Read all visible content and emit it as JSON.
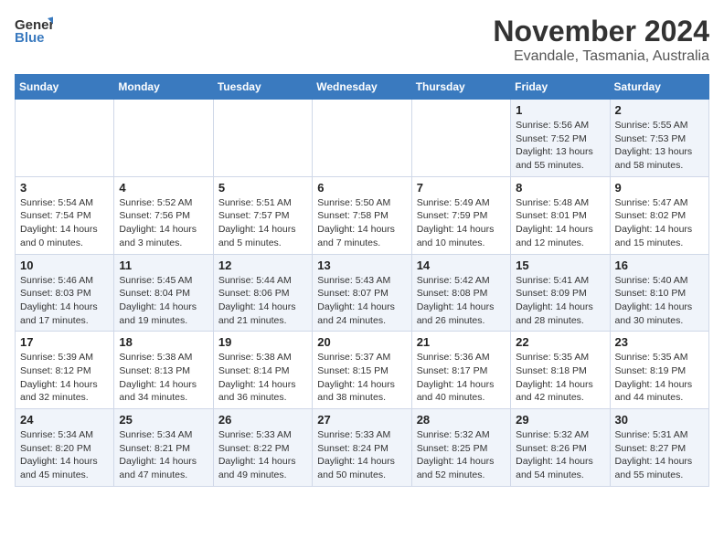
{
  "header": {
    "logo_general": "General",
    "logo_blue": "Blue",
    "month_title": "November 2024",
    "location": "Evandale, Tasmania, Australia"
  },
  "calendar": {
    "days_of_week": [
      "Sunday",
      "Monday",
      "Tuesday",
      "Wednesday",
      "Thursday",
      "Friday",
      "Saturday"
    ],
    "weeks": [
      [
        {
          "day": "",
          "info": ""
        },
        {
          "day": "",
          "info": ""
        },
        {
          "day": "",
          "info": ""
        },
        {
          "day": "",
          "info": ""
        },
        {
          "day": "",
          "info": ""
        },
        {
          "day": "1",
          "info": "Sunrise: 5:56 AM\nSunset: 7:52 PM\nDaylight: 13 hours and 55 minutes."
        },
        {
          "day": "2",
          "info": "Sunrise: 5:55 AM\nSunset: 7:53 PM\nDaylight: 13 hours and 58 minutes."
        }
      ],
      [
        {
          "day": "3",
          "info": "Sunrise: 5:54 AM\nSunset: 7:54 PM\nDaylight: 14 hours and 0 minutes."
        },
        {
          "day": "4",
          "info": "Sunrise: 5:52 AM\nSunset: 7:56 PM\nDaylight: 14 hours and 3 minutes."
        },
        {
          "day": "5",
          "info": "Sunrise: 5:51 AM\nSunset: 7:57 PM\nDaylight: 14 hours and 5 minutes."
        },
        {
          "day": "6",
          "info": "Sunrise: 5:50 AM\nSunset: 7:58 PM\nDaylight: 14 hours and 7 minutes."
        },
        {
          "day": "7",
          "info": "Sunrise: 5:49 AM\nSunset: 7:59 PM\nDaylight: 14 hours and 10 minutes."
        },
        {
          "day": "8",
          "info": "Sunrise: 5:48 AM\nSunset: 8:01 PM\nDaylight: 14 hours and 12 minutes."
        },
        {
          "day": "9",
          "info": "Sunrise: 5:47 AM\nSunset: 8:02 PM\nDaylight: 14 hours and 15 minutes."
        }
      ],
      [
        {
          "day": "10",
          "info": "Sunrise: 5:46 AM\nSunset: 8:03 PM\nDaylight: 14 hours and 17 minutes."
        },
        {
          "day": "11",
          "info": "Sunrise: 5:45 AM\nSunset: 8:04 PM\nDaylight: 14 hours and 19 minutes."
        },
        {
          "day": "12",
          "info": "Sunrise: 5:44 AM\nSunset: 8:06 PM\nDaylight: 14 hours and 21 minutes."
        },
        {
          "day": "13",
          "info": "Sunrise: 5:43 AM\nSunset: 8:07 PM\nDaylight: 14 hours and 24 minutes."
        },
        {
          "day": "14",
          "info": "Sunrise: 5:42 AM\nSunset: 8:08 PM\nDaylight: 14 hours and 26 minutes."
        },
        {
          "day": "15",
          "info": "Sunrise: 5:41 AM\nSunset: 8:09 PM\nDaylight: 14 hours and 28 minutes."
        },
        {
          "day": "16",
          "info": "Sunrise: 5:40 AM\nSunset: 8:10 PM\nDaylight: 14 hours and 30 minutes."
        }
      ],
      [
        {
          "day": "17",
          "info": "Sunrise: 5:39 AM\nSunset: 8:12 PM\nDaylight: 14 hours and 32 minutes."
        },
        {
          "day": "18",
          "info": "Sunrise: 5:38 AM\nSunset: 8:13 PM\nDaylight: 14 hours and 34 minutes."
        },
        {
          "day": "19",
          "info": "Sunrise: 5:38 AM\nSunset: 8:14 PM\nDaylight: 14 hours and 36 minutes."
        },
        {
          "day": "20",
          "info": "Sunrise: 5:37 AM\nSunset: 8:15 PM\nDaylight: 14 hours and 38 minutes."
        },
        {
          "day": "21",
          "info": "Sunrise: 5:36 AM\nSunset: 8:17 PM\nDaylight: 14 hours and 40 minutes."
        },
        {
          "day": "22",
          "info": "Sunrise: 5:35 AM\nSunset: 8:18 PM\nDaylight: 14 hours and 42 minutes."
        },
        {
          "day": "23",
          "info": "Sunrise: 5:35 AM\nSunset: 8:19 PM\nDaylight: 14 hours and 44 minutes."
        }
      ],
      [
        {
          "day": "24",
          "info": "Sunrise: 5:34 AM\nSunset: 8:20 PM\nDaylight: 14 hours and 45 minutes."
        },
        {
          "day": "25",
          "info": "Sunrise: 5:34 AM\nSunset: 8:21 PM\nDaylight: 14 hours and 47 minutes."
        },
        {
          "day": "26",
          "info": "Sunrise: 5:33 AM\nSunset: 8:22 PM\nDaylight: 14 hours and 49 minutes."
        },
        {
          "day": "27",
          "info": "Sunrise: 5:33 AM\nSunset: 8:24 PM\nDaylight: 14 hours and 50 minutes."
        },
        {
          "day": "28",
          "info": "Sunrise: 5:32 AM\nSunset: 8:25 PM\nDaylight: 14 hours and 52 minutes."
        },
        {
          "day": "29",
          "info": "Sunrise: 5:32 AM\nSunset: 8:26 PM\nDaylight: 14 hours and 54 minutes."
        },
        {
          "day": "30",
          "info": "Sunrise: 5:31 AM\nSunset: 8:27 PM\nDaylight: 14 hours and 55 minutes."
        }
      ]
    ]
  }
}
